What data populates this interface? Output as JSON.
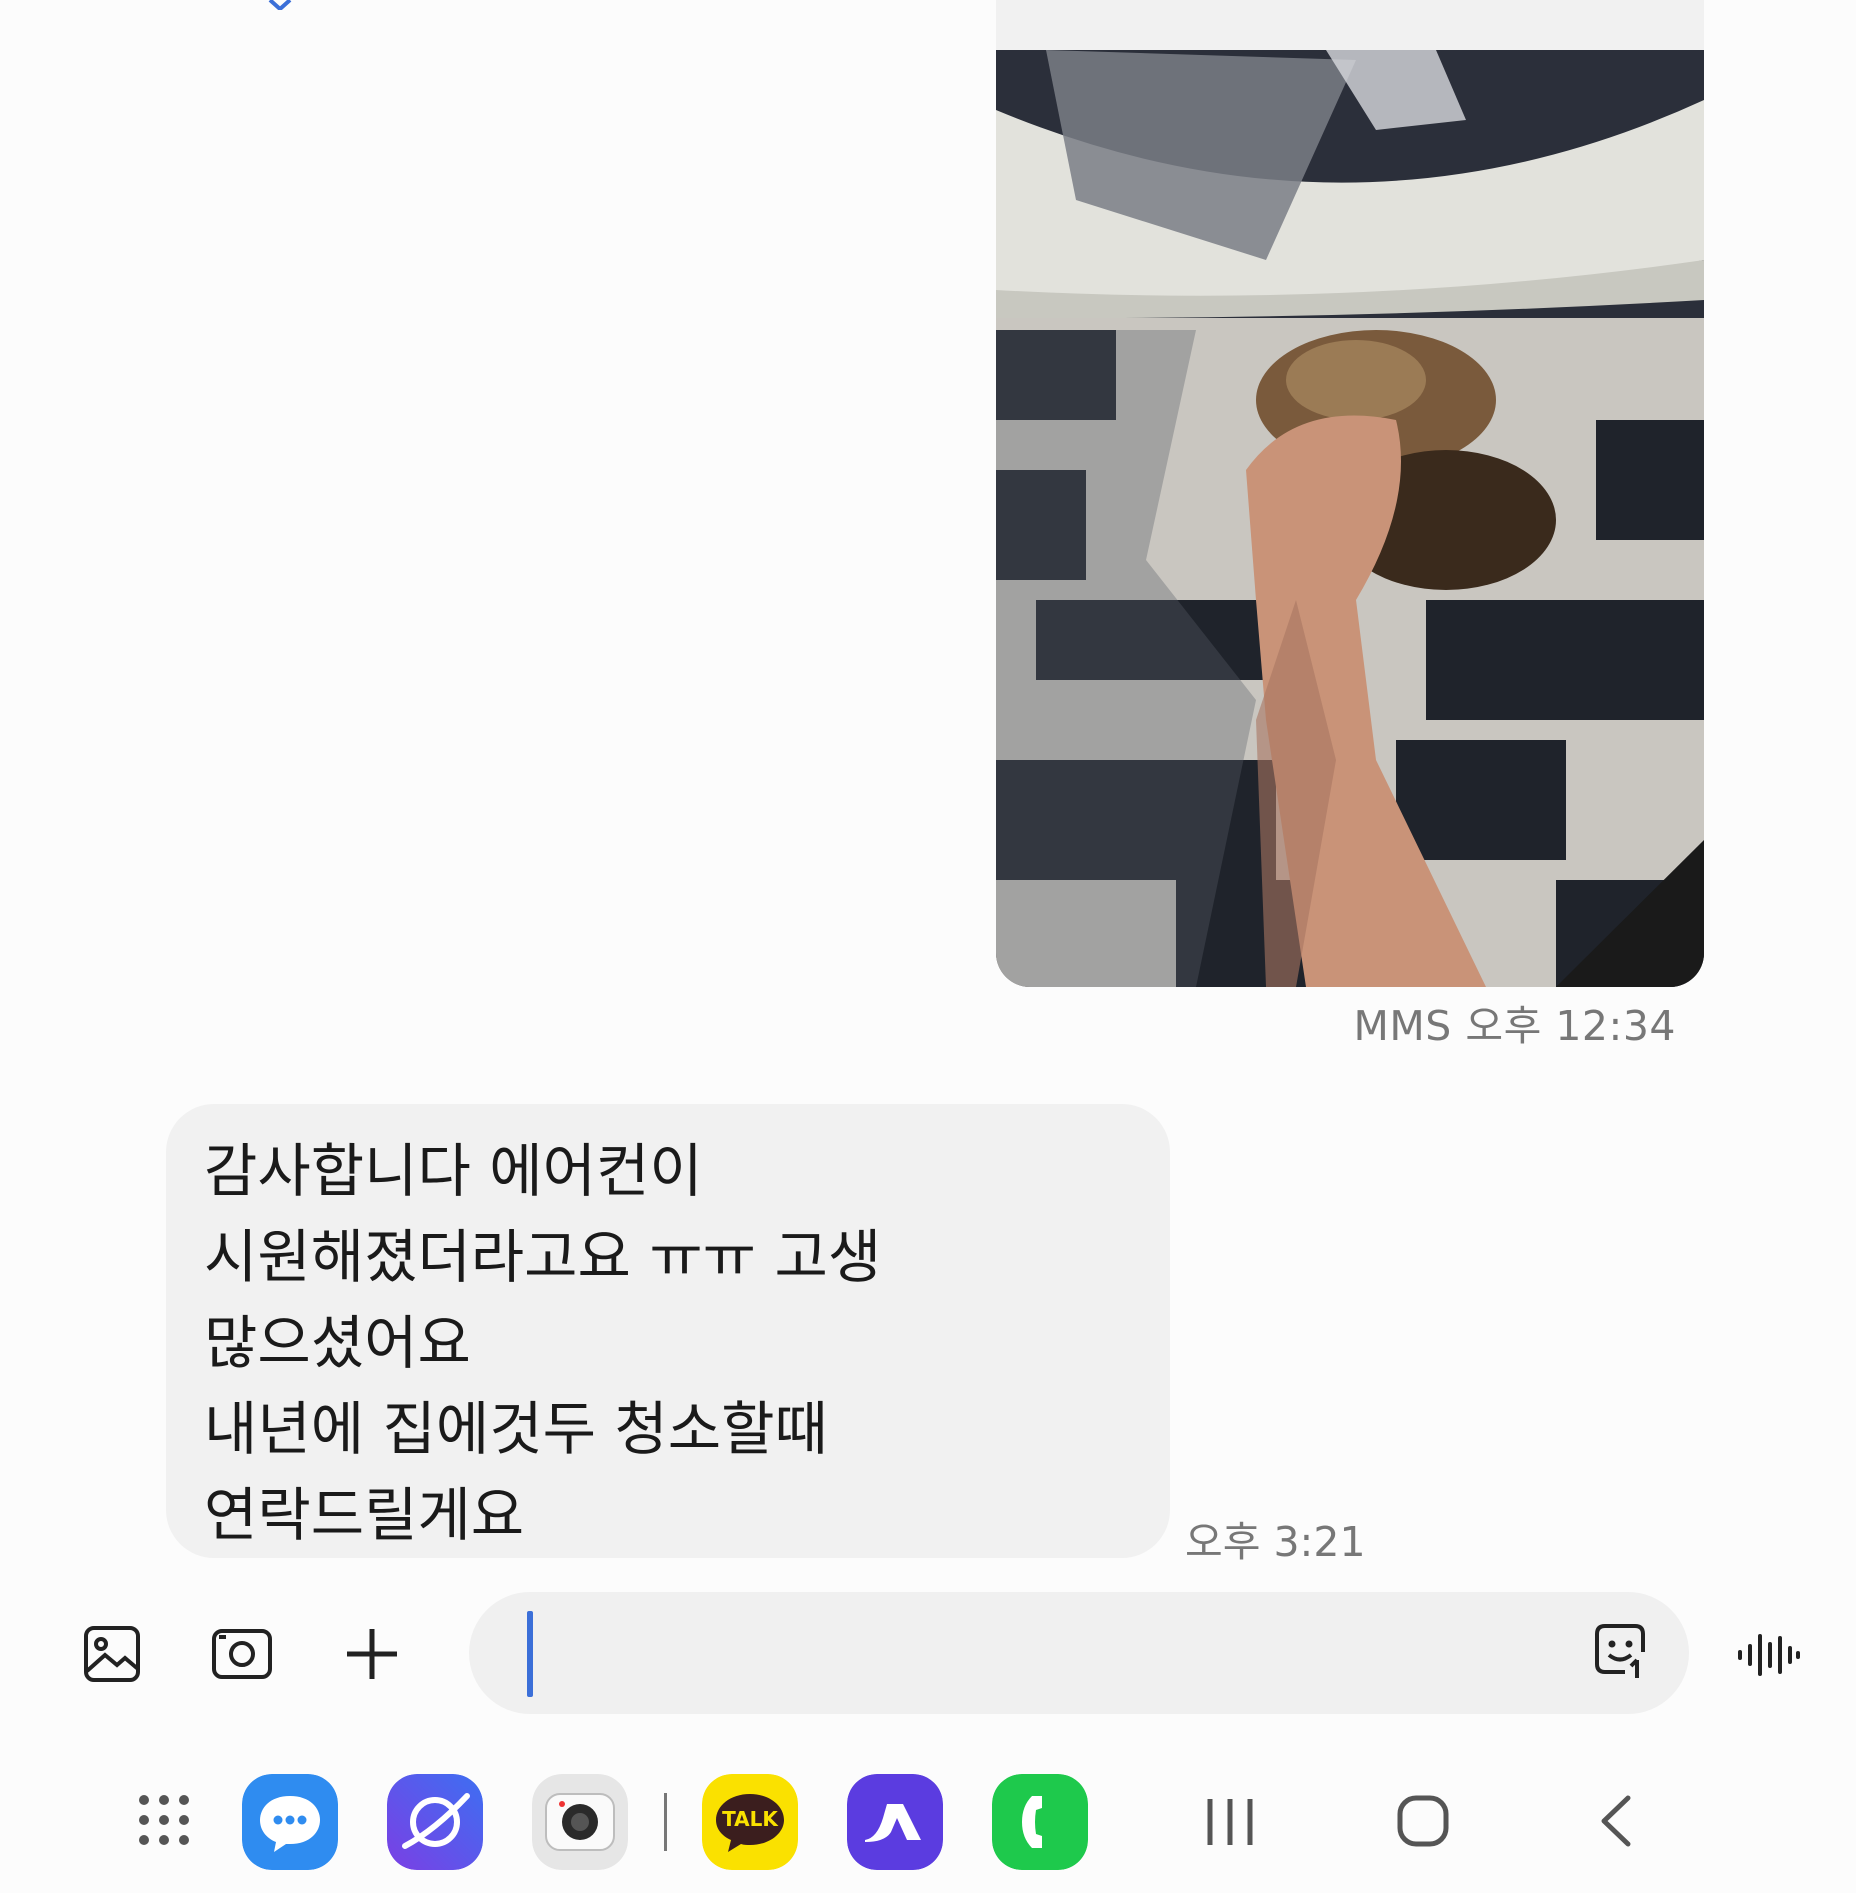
{
  "conversation": {
    "mms": {
      "type_label": "MMS",
      "time": "오후 12:34"
    },
    "incoming": {
      "lines": [
        "감사합니다 에어컨이",
        "시원해졌더라고요 ㅠㅠ 고생",
        "많으셨어요",
        "내년에 집에것두 청소할때",
        "연락드릴게요"
      ],
      "time": "오후 3:21"
    }
  },
  "composer": {
    "value": "",
    "icons": [
      "gallery-icon",
      "camera-icon",
      "plus-icon",
      "sticker-icon",
      "voice-icon"
    ]
  },
  "dock": {
    "apps": [
      {
        "name": "apps-grid-icon"
      },
      {
        "name": "messages-app-icon",
        "color": "#2f8cf0"
      },
      {
        "name": "internet-app-icon",
        "color": "#6a4cf0"
      },
      {
        "name": "camera-app-icon",
        "color": "#e8e8e8"
      },
      {
        "name": "kakaotalk-app-icon",
        "color": "#fae100",
        "label": "TALK"
      },
      {
        "name": "app-icon-purple",
        "color": "#5b3ce0"
      },
      {
        "name": "phone-app-icon",
        "color": "#1ec94c"
      }
    ],
    "nav": [
      "recents-icon",
      "home-icon",
      "back-icon"
    ]
  },
  "colors": {
    "caret": "#3b6fd8",
    "bubble": "#f1f1f1",
    "meta_text": "#777777"
  }
}
